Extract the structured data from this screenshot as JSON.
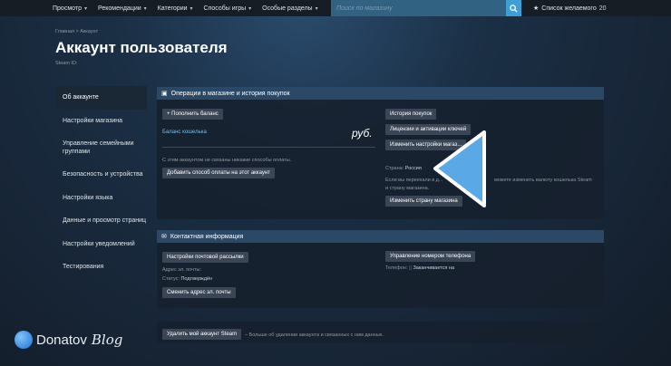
{
  "topnav": {
    "items": [
      "Просмотр",
      "Рекомендации",
      "Категории",
      "Способы игры",
      "Особые разделы"
    ],
    "search_placeholder": "Поиск по магазину",
    "wishlist_label": "Список желаемого",
    "wishlist_count": "20"
  },
  "header": {
    "breadcrumb": "Главная > Аккаунт",
    "title": "Аккаунт пользователя",
    "steam_id": "Steam ID:"
  },
  "sidebar": {
    "items": [
      "Об аккаунте",
      "Настройки магазина",
      "Управление семейными группами",
      "Безопасность и устройства",
      "Настройки языка",
      "Данные и просмотр страниц",
      "Настройки уведомлений",
      "Тестирования"
    ]
  },
  "store_panel": {
    "title": "Операции в магазине и история покупок",
    "add_funds": "+ Пополнить баланс",
    "wallet_label": "Баланс кошелька",
    "currency": "руб.",
    "no_payment": "С этим аккаунтом не связаны никакие способы оплаты.",
    "add_payment": "Добавить способ оплаты на этот аккаунт",
    "purchase_history": "История покупок",
    "licenses": "Лицензии и активации ключей",
    "change_store_settings": "Изменить настройки магаз...",
    "country_label": "Страна:",
    "country_value": "Россия",
    "country_note_1": "Если вы переехали в д...",
    "country_note_1b": "можете изменить валюту кошелька Steam",
    "country_note_2": "и страну магазина.",
    "change_country": "Изменить страну магазина"
  },
  "contact_panel": {
    "title": "Контактная информация",
    "newsletter": "Настройки почтовой рассылки",
    "email_label": "Адрес эл. почты:",
    "status_label": "Статус:",
    "status_value": "Подтверждён",
    "change_email": "Сменить адрес эл. почты",
    "manage_phone": "Управление номером телефона",
    "phone_label": "Телефон:",
    "phone_value": "Заканчивается на"
  },
  "delete_bar": {
    "button": "Удалить мой аккаунт Steam",
    "note": "– Больше об удалении аккаунта и связанных с ним данных."
  },
  "watermark": {
    "brand": "Donatov",
    "suffix": "Blog"
  },
  "colors": {
    "accent": "#66c0f4",
    "panel_header": "#2b4866",
    "button": "#3a4656",
    "pointer": "#5aa9e6"
  }
}
